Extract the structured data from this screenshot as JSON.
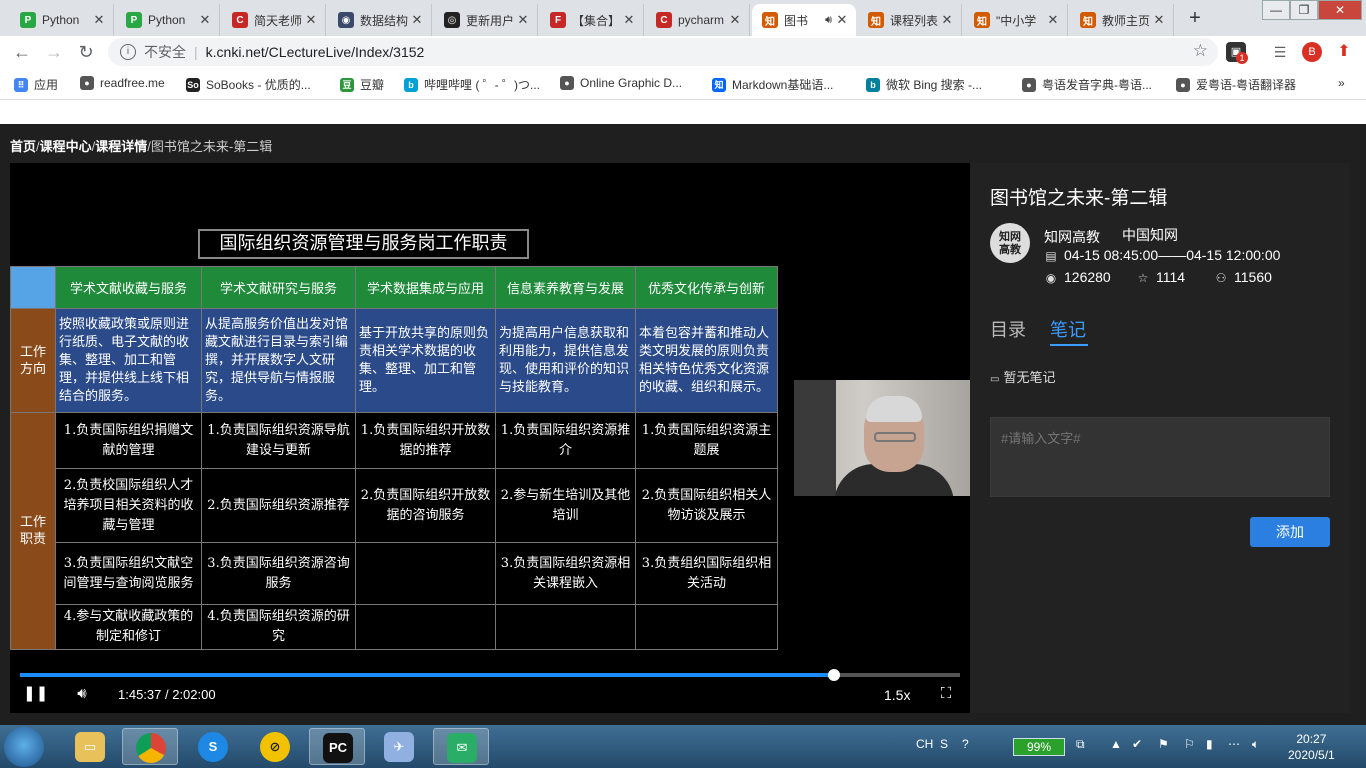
{
  "browser": {
    "tabs": [
      {
        "title": "Python",
        "fav": "P",
        "color": "#28a745"
      },
      {
        "title": "Python",
        "fav": "P",
        "color": "#28a745"
      },
      {
        "title": "简天老师",
        "fav": "C",
        "color": "#c62828"
      },
      {
        "title": "数据结构",
        "fav": "◉",
        "color": "#3a4a6a"
      },
      {
        "title": "更新用户",
        "fav": "◎",
        "color": "#222222"
      },
      {
        "title": "【集合】",
        "fav": "F",
        "color": "#c62828"
      },
      {
        "title": "pycharm",
        "fav": "C",
        "color": "#c62828"
      },
      {
        "title": "图书",
        "fav": "知",
        "color": "#d45a00"
      },
      {
        "title": "课程列表",
        "fav": "知",
        "color": "#d45a00"
      },
      {
        "title": "\"中小学",
        "fav": "知",
        "color": "#d45a00"
      },
      {
        "title": "教师主页",
        "fav": "知",
        "color": "#d45a00"
      }
    ],
    "insecure_label": "不安全",
    "url": "k.cnki.net/CLectureLive/Index/3152",
    "profile_initial": "B",
    "notification_count": "1",
    "bookmarks": [
      {
        "label": "应用",
        "fav": "⠿",
        "color": "#4285f4"
      },
      {
        "label": "readfree.me",
        "fav": "●",
        "color": "#555555"
      },
      {
        "label": "SoBooks - 优质的...",
        "fav": "So",
        "color": "#222222"
      },
      {
        "label": "豆瓣",
        "fav": "豆",
        "color": "#2e963d"
      },
      {
        "label": "哔哩哔哩 ( ゜- ゜)つ...",
        "fav": "b",
        "color": "#00a1d6"
      },
      {
        "label": "Online Graphic D...",
        "fav": "●",
        "color": "#555555"
      },
      {
        "label": "Markdown基础语...",
        "fav": "知",
        "color": "#0066ff"
      },
      {
        "label": "微软 Bing 搜索 -...",
        "fav": "b",
        "color": "#00809d"
      },
      {
        "label": "粤语发音字典-粤语...",
        "fav": "●",
        "color": "#555555"
      },
      {
        "label": "爱粤语-粤语翻译器",
        "fav": "●",
        "color": "#555555"
      }
    ],
    "more_bookmarks": "»"
  },
  "page": {
    "breadcrumb": [
      "首页",
      "课程中心",
      "课程详情",
      "图书馆之未来-第二辑"
    ],
    "breadcrumb_sep": "/"
  },
  "slide": {
    "title": "国际组织资源管理与服务岗工作职责",
    "columns": [
      "学术文献收藏与服务",
      "学术文献研究与服务",
      "学术数据集成与应用",
      "信息素养教育与发展",
      "优秀文化传承与创新"
    ],
    "row_label_direction": "工作方向",
    "row_label_duties": "工作职责",
    "directions": [
      "按照收藏政策或原则进行纸质、电子文献的收集、整理、加工和管理，并提供线上线下相结合的服务。",
      "从提高服务价值出发对馆藏文献进行目录与索引编撰，并开展数字人文研究，提供导航与情报服务。",
      "基于开放共享的原则负责相关学术数据的收集、整理、加工和管理。",
      "为提高用户信息获取和利用能力，提供信息发现、使用和评价的知识与技能教育。",
      "本着包容并蓄和推动人类文明发展的原则负责相关特色优秀文化资源的收藏、组织和展示。"
    ],
    "duties": [
      [
        "1.负责国际组织捐赠文献的管理",
        "1.负责国际组织资源导航建设与更新",
        "1.负责国际组织开放数据的推荐",
        "1.负责国际组织资源推介",
        "1.负责国际组织资源主题展"
      ],
      [
        "2.负责校国际组织人才培养项目相关资料的收藏与管理",
        "2.负责国际组织资源推荐",
        "2.负责国际组织开放数据的咨询服务",
        "2.参与新生培训及其他培训",
        "2.负责国际组织相关人物访谈及展示"
      ],
      [
        "3.负责国际组织文献空间管理与查询阅览服务",
        "3.负责国际组织资源咨询服务",
        "",
        "3.负责国际组织资源相关课程嵌入",
        "3.负责组织国际组织相关活动"
      ],
      [
        "4.参与文献收藏政策的制定和修订",
        "4.负责国际组织资源的研究",
        "",
        "",
        ""
      ]
    ]
  },
  "player": {
    "time": "1:45:37 / 2:02:00",
    "progress": 0.8655,
    "speed": "1.5x"
  },
  "course": {
    "title": "图书馆之未来-第二辑",
    "avatar_text": "知网高教",
    "org1": "知网高教",
    "org2": "中国知网",
    "schedule": "04-15 08:45:00——04-15 12:00:00",
    "views": "126280",
    "stars": "1114",
    "participants": "11560",
    "tab_toc": "目录",
    "tab_notes": "笔记",
    "no_notes": "暂无笔记",
    "note_placeholder": "#请输入文字#",
    "add_label": "添加"
  },
  "taskbar": {
    "lang": "CH",
    "battery": "99%",
    "time": "20:27",
    "date": "2020/5/1"
  }
}
